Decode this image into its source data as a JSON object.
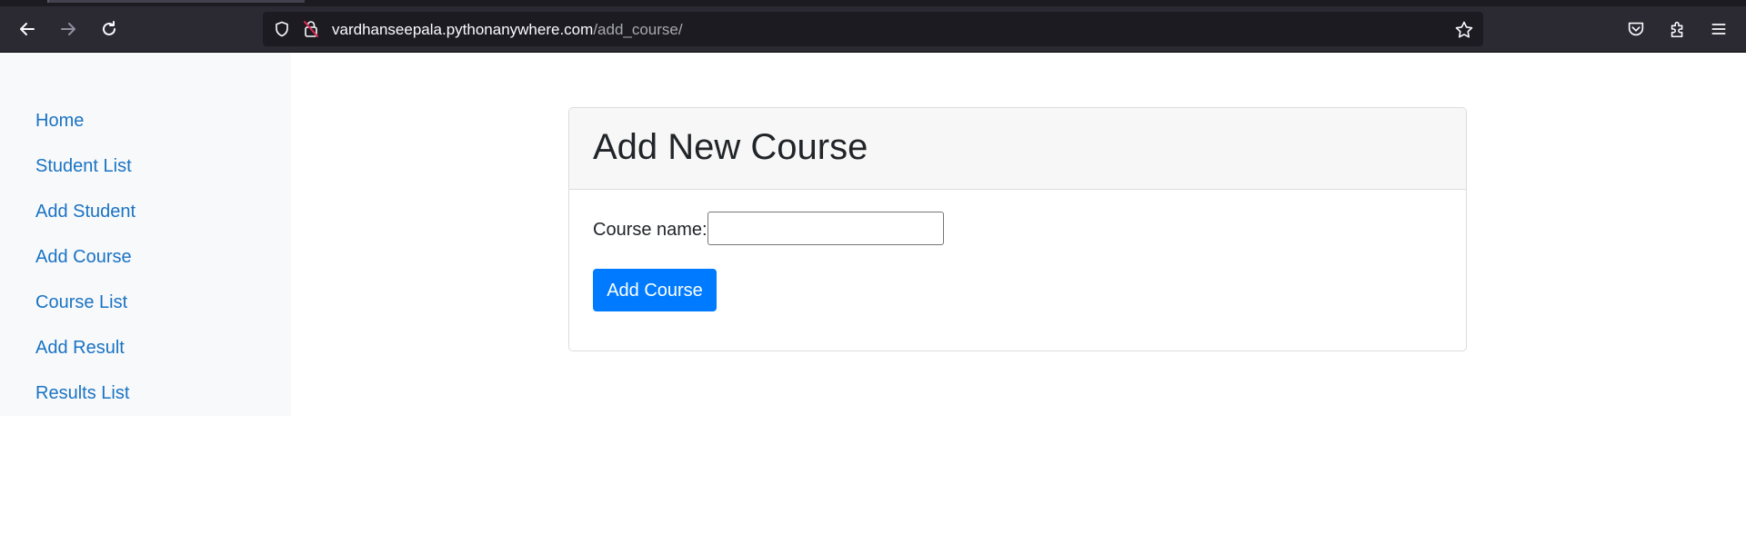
{
  "browser": {
    "url_host": "vardhanseepala.pythonanywhere.com",
    "url_path": "/add_course/",
    "icons": {
      "back": "back-arrow-icon",
      "forward": "forward-arrow-icon",
      "reload": "reload-icon",
      "tracking": "shield-icon",
      "security": "insecure-lock-icon",
      "bookmark": "star-icon",
      "pocket": "pocket-icon",
      "extensions": "puzzle-icon",
      "menu": "hamburger-menu-icon"
    },
    "colors": {
      "toolbar": "#2b2a33",
      "urlbar": "#1c1b22"
    }
  },
  "sidebar": {
    "items": [
      {
        "label": "Home"
      },
      {
        "label": "Student List"
      },
      {
        "label": "Add Student"
      },
      {
        "label": "Add Course"
      },
      {
        "label": "Course List"
      },
      {
        "label": "Add Result"
      },
      {
        "label": "Results List"
      }
    ],
    "link_color": "#1a73c4"
  },
  "card": {
    "title": "Add New Course",
    "field_label": "Course name:",
    "field_value": "",
    "submit_label": "Add Course",
    "accent": "#007bff"
  }
}
